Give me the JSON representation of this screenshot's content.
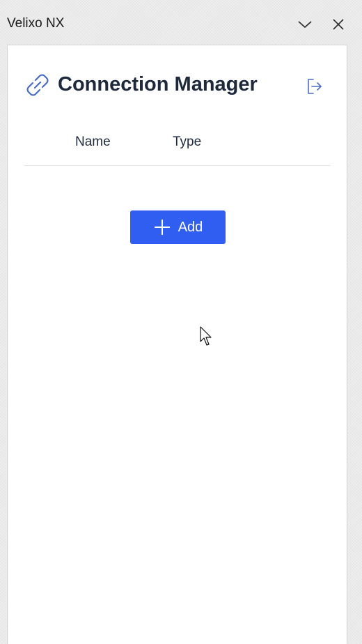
{
  "window": {
    "title": "Velixo NX",
    "collapse_icon": "chevron-down-icon",
    "close_icon": "close-icon"
  },
  "header": {
    "title": "Connection Manager",
    "icon": "link-icon",
    "action_icon": "sign-out-icon"
  },
  "table": {
    "columns": [
      "Name",
      "Type"
    ],
    "rows": []
  },
  "actions": {
    "add_label": "Add",
    "add_icon": "plus-icon"
  },
  "colors": {
    "accent": "#2f5ef0",
    "heading": "#1e2a3b",
    "icon": "#4a6cc4"
  }
}
